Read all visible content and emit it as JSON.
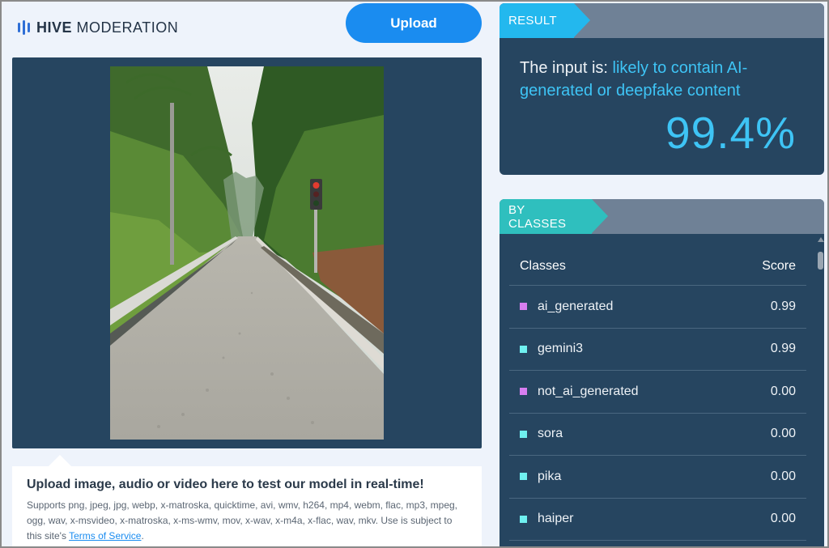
{
  "header": {
    "logo_strong": "HIVE",
    "logo_rest": "MODERATION",
    "upload_label": "Upload"
  },
  "preview": {
    "image_description": "gravel road between tropical trees with traffic light"
  },
  "info": {
    "title": "Upload image, audio or video here to test our model in real-time!",
    "supports": "Supports png, jpeg, jpg, webp, x-matroska, quicktime, avi, wmv, h264, mp4, webm, flac, mp3, mpeg, ogg, wav, x-msvideo, x-matroska, x-ms-wmv, mov, x-wav, x-m4a, x-flac, wav, mkv. Use is subject to this site's ",
    "tos_link": "Terms of Service",
    "tos_end": "."
  },
  "result": {
    "tab": "RESULT",
    "prefix": "The input is: ",
    "verdict": "likely to contain AI-generated or deepfake content",
    "score": "99.4%"
  },
  "classes": {
    "tab": "BY CLASSES",
    "col_class": "Classes",
    "col_score": "Score",
    "rows": [
      {
        "name": "ai_generated",
        "score": "0.99",
        "color": "#d77ef0"
      },
      {
        "name": "gemini3",
        "score": "0.99",
        "color": "#6ff0f0"
      },
      {
        "name": "not_ai_generated",
        "score": "0.00",
        "color": "#d77ef0"
      },
      {
        "name": "sora",
        "score": "0.00",
        "color": "#6ff0f0"
      },
      {
        "name": "pika",
        "score": "0.00",
        "color": "#6ff0f0"
      },
      {
        "name": "haiper",
        "score": "0.00",
        "color": "#6ff0f0"
      }
    ]
  },
  "colors": {
    "accent_blue": "#1a8cf0",
    "panel_bg": "#264560",
    "highlight": "#3ec4f5",
    "teal": "#2fbfbe"
  }
}
